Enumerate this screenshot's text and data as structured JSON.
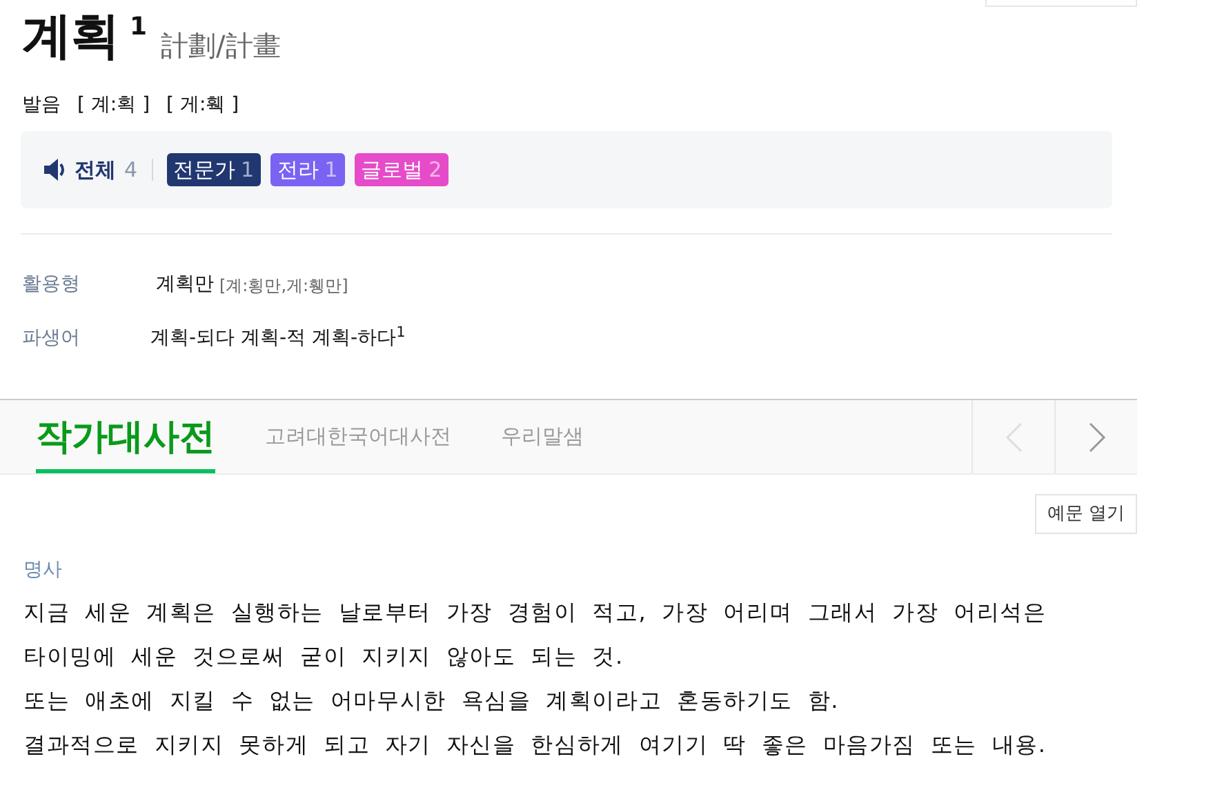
{
  "headword": {
    "word": "계획",
    "homonym": "1",
    "hanja": "計劃/計畫"
  },
  "pronunciation": {
    "label": "발음",
    "variants": [
      "[ 계:획 ]",
      "[ 게:훽 ]"
    ]
  },
  "audio": {
    "label": "전체",
    "count": "4",
    "groups": [
      {
        "label": "전문가",
        "count": "1",
        "color": "#213770"
      },
      {
        "label": "전라",
        "count": "1",
        "color": "#7a62f2"
      },
      {
        "label": "글로벌",
        "count": "2",
        "color": "#e64bc9"
      }
    ]
  },
  "forms": [
    {
      "label": "활용형",
      "value": "계획만",
      "note": "[계:횡만,게:휑만]"
    },
    {
      "label": "파생어",
      "value": "계획-되다 계획-적 계획-하다$^{1}$"
    }
  ],
  "tabs": [
    {
      "label": "작가대사전",
      "selected": true
    },
    {
      "label": "고려대한국어대사전",
      "selected": false
    },
    {
      "label": "우리말샘",
      "selected": false
    }
  ],
  "pager": {
    "prev_disabled": true,
    "next_disabled": false
  },
  "examples_button": "예문 열기",
  "part_of_speech": "명사",
  "definition_lines": [
    "지금 세운 계획은 실행하는 날로부터 가장 경험이 적고, 가장 어리며 그래서 가장 어리석은",
    "타이밍에 세운 것으로써 굳이 지키지 않아도 되는 것.",
    "또는 애초에 지킬 수 없는 어마무시한 욕심을 계획이라고 혼동하기도 함.",
    "결과적으로 지키지 못하게 되고 자기 자신을 한심하게 여기기 딱 좋은 마음가짐 또는 내용."
  ]
}
